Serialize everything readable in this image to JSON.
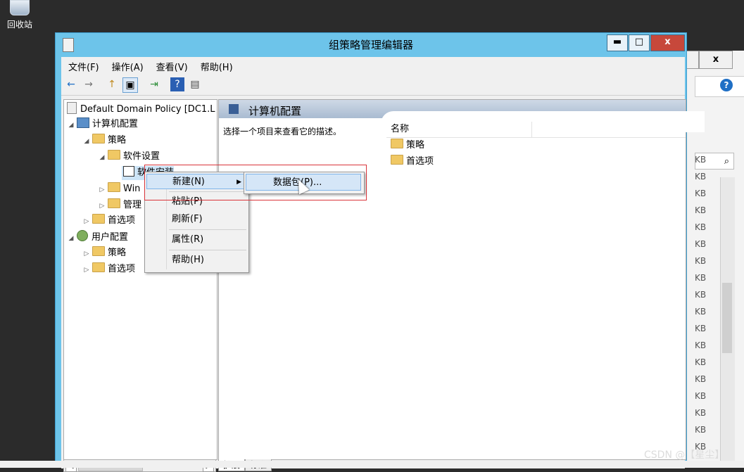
{
  "desktop": {
    "recycle_bin_label": "回收站"
  },
  "window": {
    "title": "组策略管理编辑器",
    "minimize": "▬",
    "maximize": "□",
    "close": "x"
  },
  "menubar": [
    "文件(F)",
    "操作(A)",
    "查看(V)",
    "帮助(H)"
  ],
  "toolbar": {
    "back": "←",
    "forward": "→",
    "up": "↑",
    "show_hide": "▣",
    "export": "⇥",
    "help": "?",
    "view": "▤"
  },
  "tree": {
    "root": "Default Domain Policy [DC1.L",
    "computer_config": "计算机配置",
    "policies": "策略",
    "software_settings": "软件设置",
    "software_install": "软件安装",
    "windows_settings": "Win",
    "admin_templates": "管理",
    "preferences": "首选项",
    "user_config": "用户配置",
    "user_policies": "策略",
    "user_preferences": "首选项",
    "scroll_thumb": "III"
  },
  "right_pane": {
    "header": "计算机配置",
    "description": "选择一个项目来查看它的描述。",
    "column_name": "名称",
    "items": [
      "策略",
      "首选项"
    ]
  },
  "tabs": [
    "扩展",
    "标准"
  ],
  "context_menu": {
    "new": "新建(N)",
    "paste": "粘贴(P)",
    "refresh": "刷新(F)",
    "properties": "属性(R)",
    "help": "帮助(H)"
  },
  "submenu": {
    "package": "数据包(P)..."
  },
  "background_window": {
    "close": "x",
    "kb_label": "KB"
  },
  "watermark": "CSDN @【星尘】",
  "colors": {
    "title_bar": "#6dc4ea",
    "close_button": "#c7483b",
    "highlight": "#d5e6f7",
    "annotation_box": "#d9343a"
  }
}
